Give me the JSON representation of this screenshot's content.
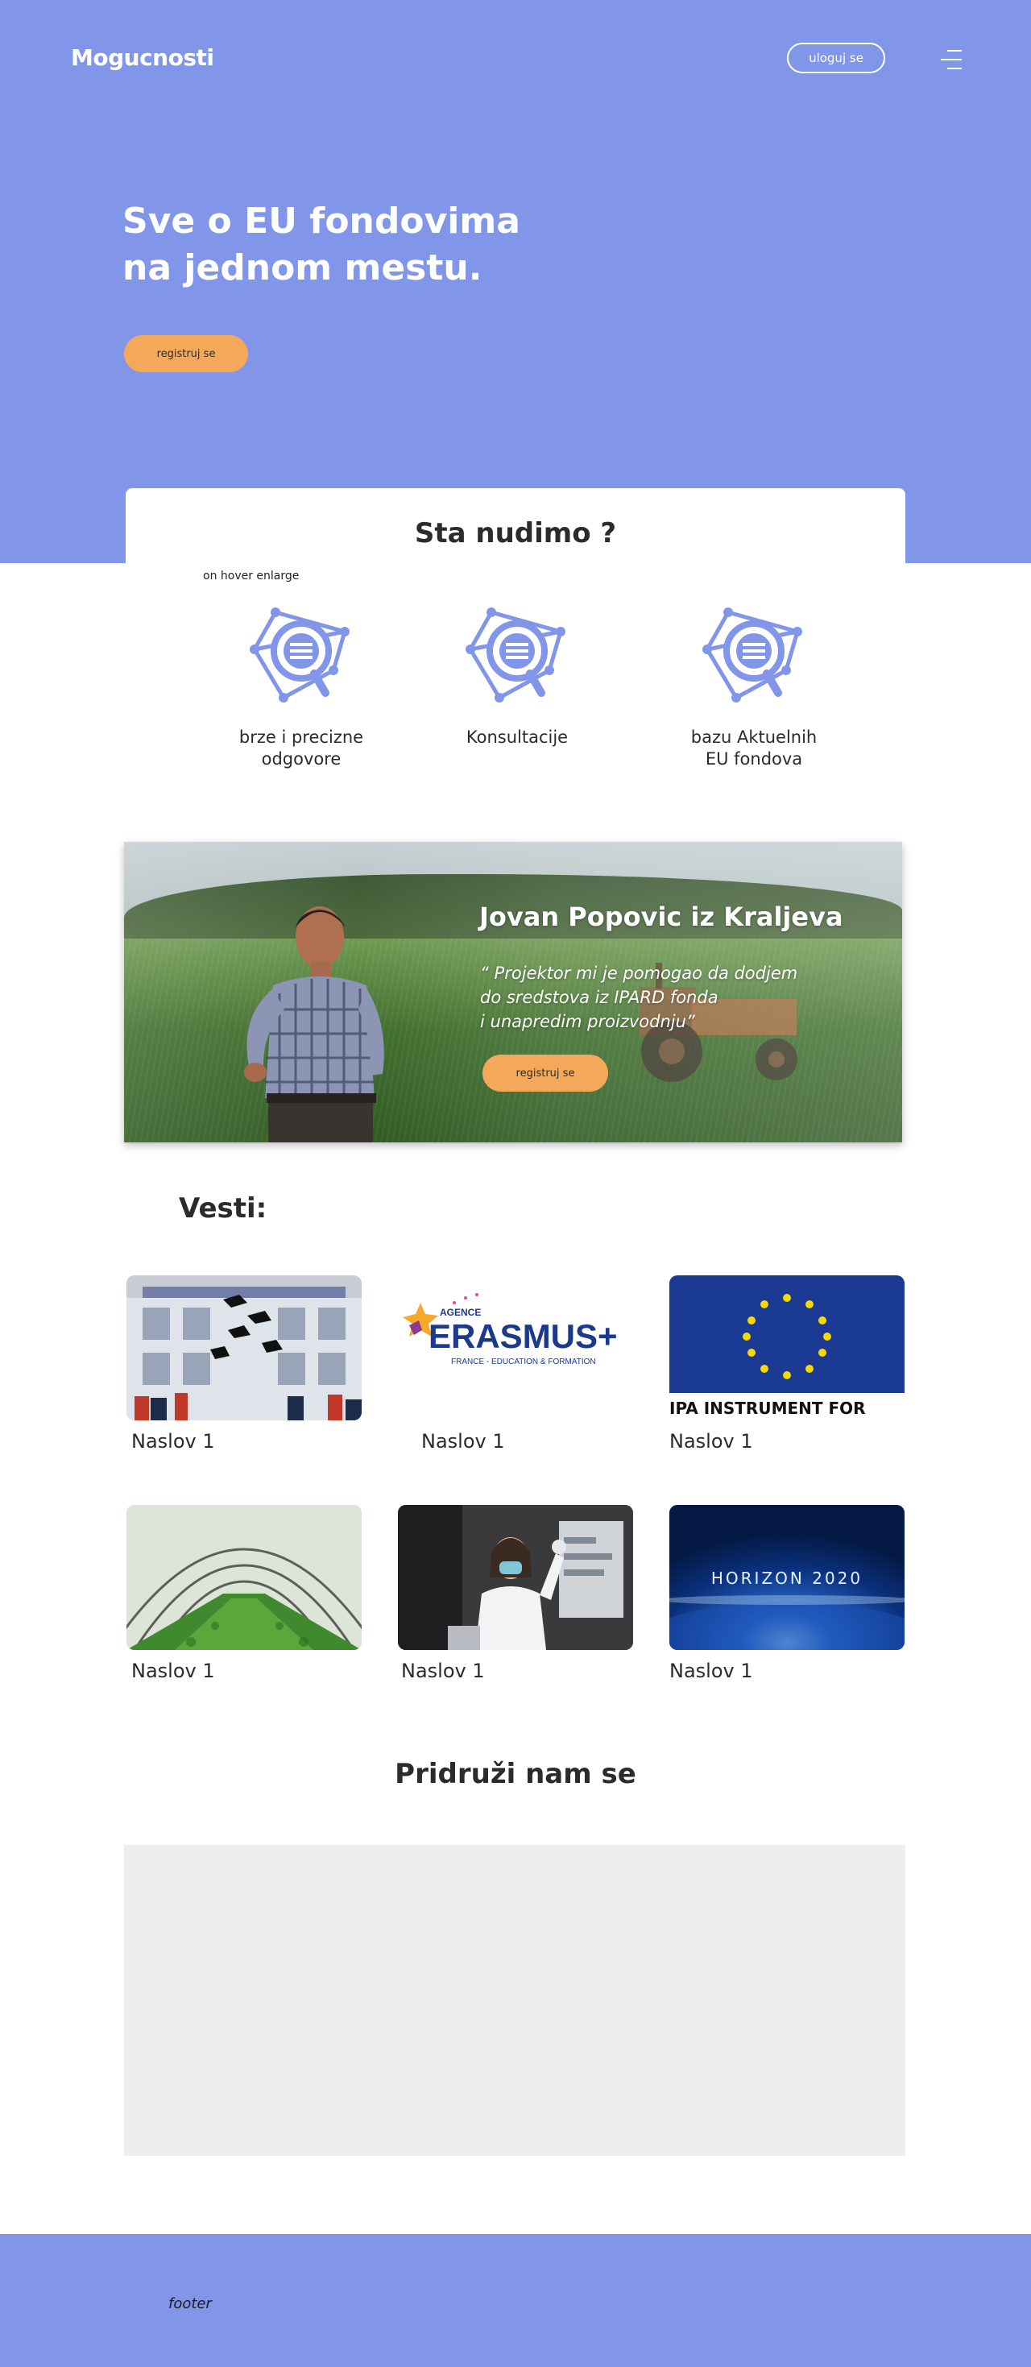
{
  "header": {
    "logo": "Mogucnosti",
    "login_label": "uloguj se"
  },
  "hero": {
    "title_line1": "Sve o EU fondovima",
    "title_line2": "na jednom mestu.",
    "cta_label": "registruj se"
  },
  "offer": {
    "title": "Sta nudimo ?",
    "hover_note": "on hover enlarge",
    "items": [
      {
        "label_line1": "brze i precizne",
        "label_line2": "odgovore",
        "icon": "search-network-icon"
      },
      {
        "label_line1": "Konsultacije",
        "label_line2": "",
        "icon": "search-network-icon"
      },
      {
        "label_line1": "bazu Aktuelnih",
        "label_line2": "EU fondova",
        "icon": "search-network-icon"
      }
    ]
  },
  "testimonial": {
    "name": "Jovan Popovic iz Kraljeva",
    "quote_line1": "“ Projektor mi je pomogao da dodjem",
    "quote_line2": "do sredstova iz IPARD fonda",
    "quote_line3": "i unapredim proizvodnju”",
    "cta_label": "registruj se"
  },
  "news": {
    "heading": "Vesti:",
    "items": [
      {
        "title": "Naslov 1",
        "thumb": "graduation-photo"
      },
      {
        "title": "Naslov 1",
        "thumb": "erasmus-logo",
        "logo_small": "AGENCE",
        "logo_main": "ERASMUS+",
        "logo_sub": "FRANCE - EDUCATION & FORMATION"
      },
      {
        "title": "Naslov 1",
        "thumb": "eu-flag",
        "caption": "IPA INSTRUMENT FOR"
      },
      {
        "title": "Naslov 1",
        "thumb": "greenhouse-photo"
      },
      {
        "title": "Naslov 1",
        "thumb": "lab-scientist-photo"
      },
      {
        "title": "Naslov 1",
        "thumb": "horizon-2020",
        "caption": "HORIZON 2020"
      }
    ]
  },
  "join": {
    "heading": "Pridruži nam se"
  },
  "footer": {
    "text": "footer"
  },
  "colors": {
    "brand": "#8195e9",
    "accent": "#f4a95a",
    "text": "#2b2b2b",
    "placeholder": "#eeeeee"
  }
}
